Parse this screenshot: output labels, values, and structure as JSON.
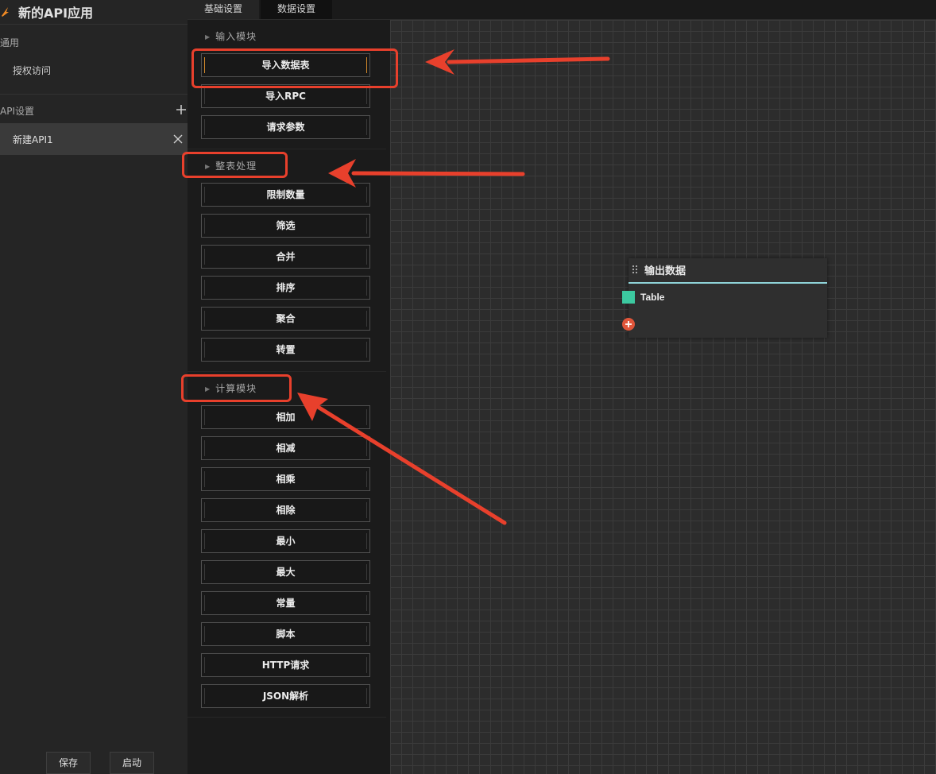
{
  "app": {
    "title": "新的API应用"
  },
  "sidebar": {
    "general_label": "通用",
    "auth_item": "授权访问",
    "api_settings_label": "API设置",
    "api_items": [
      {
        "label": "新建API1"
      }
    ]
  },
  "footer": {
    "save_label": "保存",
    "start_label": "启动"
  },
  "tabs": [
    {
      "label": "基础设置"
    },
    {
      "label": "数据设置"
    }
  ],
  "module_groups": [
    {
      "title": "输入模块",
      "items": [
        "导入数据表",
        "导入RPC",
        "请求参数"
      ]
    },
    {
      "title": "整表处理",
      "items": [
        "限制数量",
        "筛选",
        "合并",
        "排序",
        "聚合",
        "转置"
      ]
    },
    {
      "title": "计算模块",
      "items": [
        "相加",
        "相减",
        "相乘",
        "相除",
        "最小",
        "最大",
        "常量",
        "脚本",
        "HTTP请求",
        "JSON解析"
      ]
    }
  ],
  "canvas": {
    "node": {
      "title": "输出数据",
      "port_label": "Table"
    }
  },
  "colors": {
    "accent_orange": "#d48a2b",
    "annotation_red": "#e8402c",
    "port_green": "#3cc9a0",
    "add_port_red": "#e0553a",
    "node_underline": "#8fd3d8"
  },
  "icons": {
    "logo": "app-logo-icon",
    "add": "plus-icon",
    "close": "close-icon",
    "drag": "drag-handle-icon",
    "group_toggle": "triangle-right-icon",
    "add_port": "plus-circle-icon"
  }
}
